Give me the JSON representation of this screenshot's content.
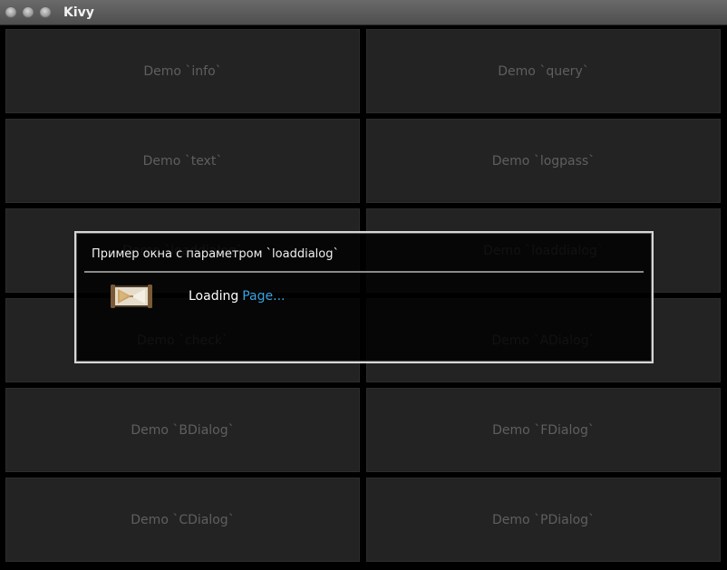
{
  "window": {
    "title": "Kivy"
  },
  "buttons": [
    {
      "label": "Demo `info`"
    },
    {
      "label": "Demo `query`"
    },
    {
      "label": "Demo `text`"
    },
    {
      "label": "Demo `logpass`"
    },
    {
      "label": "Demo `loaddialog`"
    },
    {
      "label": "Demo `loaddialog`"
    },
    {
      "label": "Demo `check`"
    },
    {
      "label": "Demo `ADialog`"
    },
    {
      "label": "Demo `BDialog`"
    },
    {
      "label": "Demo `FDialog`"
    },
    {
      "label": "Demo `CDialog`"
    },
    {
      "label": "Demo `PDialog`"
    }
  ],
  "dialog": {
    "title": "Пример окна с параметром `loaddialog`",
    "loading_label": "Loading",
    "loading_target": "Page...",
    "icon": "hourglass-icon"
  },
  "colors": {
    "background": "#000000",
    "button_bg": "#232323",
    "button_text": "#5f5f5f",
    "link": "#3aa4e0"
  }
}
